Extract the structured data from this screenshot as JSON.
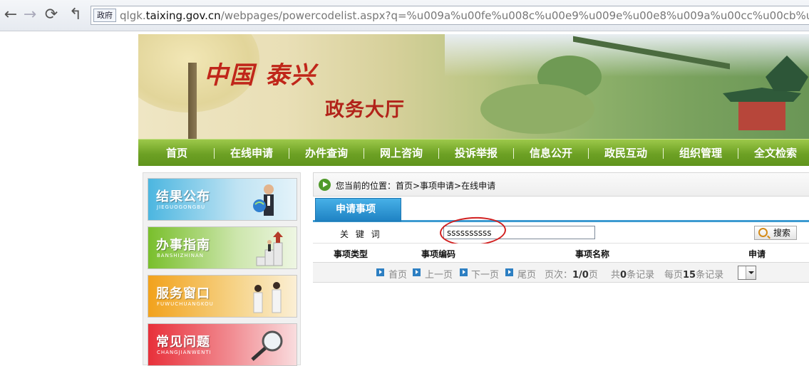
{
  "browser": {
    "url_chip": "政府",
    "url_prefix": "qlgk.",
    "url_host": "taixing.gov.cn",
    "url_path": "/webpages/powercodelist.aspx?q=%u009a%u00fe%u008c%u00e9%u009e%u00e8%u009a%u00cc%u00cb%u0"
  },
  "banner": {
    "logo": "中国 泰兴",
    "hall": "政务大厅"
  },
  "nav": [
    "首页",
    "在线申请",
    "办件查询",
    "网上咨询",
    "投诉举报",
    "信息公开",
    "政民互动",
    "组织管理",
    "全文检索"
  ],
  "sidebar": {
    "cards": [
      {
        "title": "结果公布",
        "pinyin": "JIEGUOGONGBU",
        "color_from": "#4cb6e0",
        "color_to": "#d9eef7"
      },
      {
        "title": "办事指南",
        "pinyin": "BANSHIZHINAN",
        "color_from": "#79bf2c",
        "color_to": "#e4f1d2"
      },
      {
        "title": "服务窗口",
        "pinyin": "FUWUCHUANGKOU",
        "color_from": "#f2a21c",
        "color_to": "#f8e4b4"
      },
      {
        "title": "常见问题",
        "pinyin": "CHANGJIANWENTI",
        "color_from": "#e8303a",
        "color_to": "#f5c7c9"
      }
    ]
  },
  "breadcrumb": "您当前的位置：首页>事项申请>在线申请",
  "tab": "申请事项",
  "search": {
    "label": "关 键 词",
    "value": "ssssssssss",
    "button": "搜索"
  },
  "table": {
    "headers": [
      "事项类型",
      "事项编码",
      "事项名称",
      "申请"
    ]
  },
  "pager": {
    "first": "首页",
    "prev": "上一页",
    "next": "下一页",
    "last": "尾页",
    "page_label": "页次：",
    "page_value": "1/0",
    "page_suffix": "页",
    "total_prefix": "共",
    "total_value": "0",
    "total_suffix": "条记录",
    "per_prefix": "每页",
    "per_value": "15",
    "per_suffix": "条记录"
  }
}
